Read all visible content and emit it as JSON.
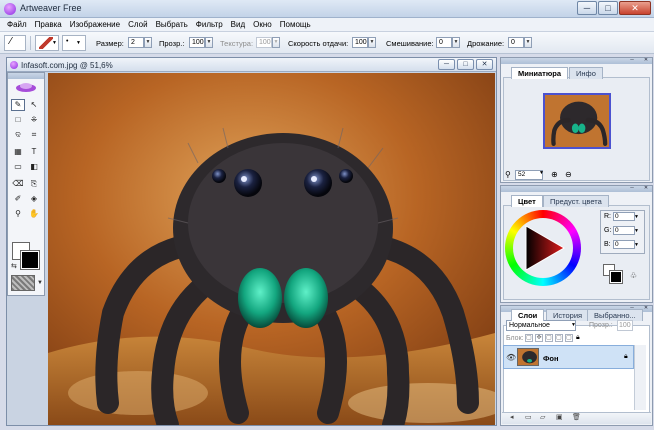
{
  "app": {
    "title": "Artweaver Free"
  },
  "window_buttons": {
    "minimize": "─",
    "maximize": "□",
    "close": "✕"
  },
  "menu": [
    "Файл",
    "Правка",
    "Изображение",
    "Слой",
    "Выбрать",
    "Фильтр",
    "Вид",
    "Окно",
    "Помощь"
  ],
  "toolbar": {
    "size_label": "Размер:",
    "size_value": "2",
    "opacity_label": "Прозр.:",
    "opacity_value": "100",
    "texture_label": "Текстура:",
    "texture_value": "100",
    "speed_label": "Скорость отдачи:",
    "speed_value": "100",
    "blend_label": "Смешивание:",
    "blend_value": "0",
    "jitter_label": "Дрожание:",
    "jitter_value": "0"
  },
  "document": {
    "title": "Infasoft.com.jpg @ 51,6%"
  },
  "tools": {
    "items": [
      "✎",
      "↖",
      "□",
      "⁜",
      "ଦ",
      "⌗",
      "▦",
      "T",
      "▭",
      "◧",
      "⌫",
      "⎘",
      "✐",
      "◈",
      "⚲",
      "✋"
    ]
  },
  "navigator": {
    "tabs": [
      "Миниатюра",
      "Инфо"
    ],
    "zoom_value": "52"
  },
  "color": {
    "tabs": [
      "Цвет",
      "Предуст. цвета"
    ],
    "r_label": "R:",
    "r_value": "0",
    "g_label": "G:",
    "g_value": "0",
    "b_label": "B:",
    "b_value": "0",
    "foreground": "#000000",
    "background": "#ffffff"
  },
  "layers": {
    "tabs": [
      "Слои",
      "История",
      "Выбранно..."
    ],
    "blend_mode": "Нормальное",
    "opacity_label": "Прозр.:",
    "opacity_value": "100",
    "lock_label": "Блок:",
    "items": [
      {
        "name": "Фон",
        "visible": true,
        "locked": true
      }
    ]
  }
}
